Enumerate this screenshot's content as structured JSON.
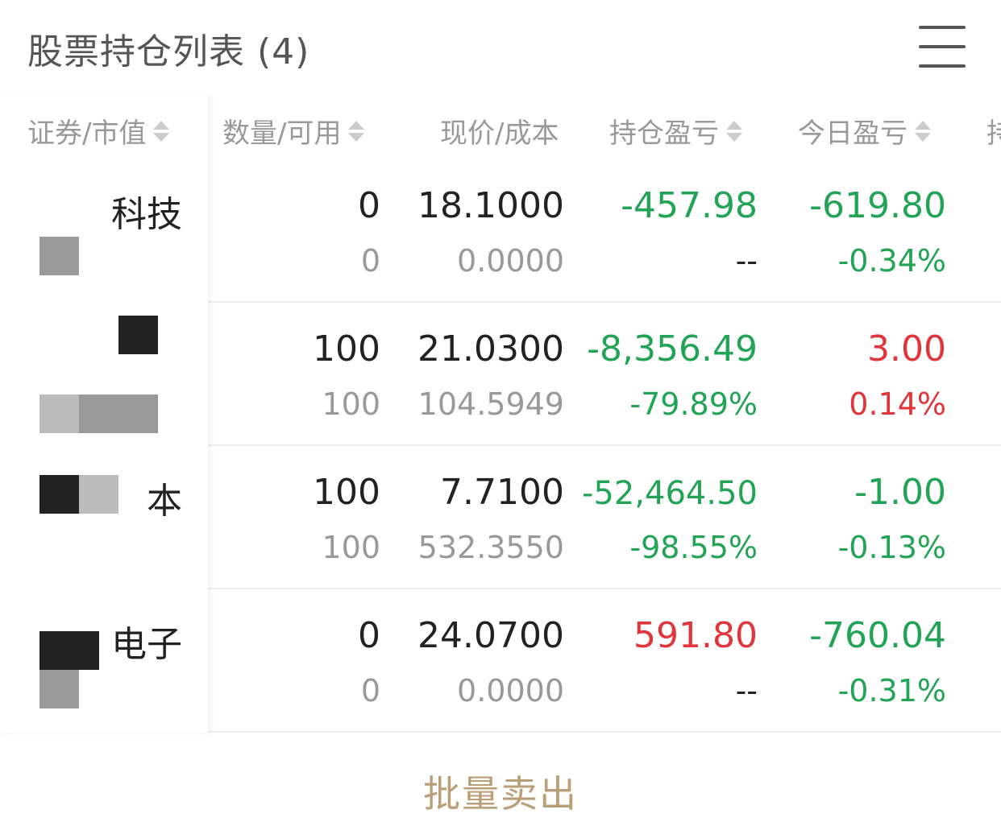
{
  "header": {
    "title": "股票持仓列表 (4)",
    "menu_icon": "hamburger-menu-icon"
  },
  "columns": [
    {
      "label": "证券/市值",
      "sortable": true
    },
    {
      "label": "数量/可用",
      "sortable": true
    },
    {
      "label": "现价/成本",
      "sortable": false
    },
    {
      "label": "持仓盈亏",
      "sortable": true
    },
    {
      "label": "今日盈亏",
      "sortable": true
    },
    {
      "label": "持",
      "sortable": false
    }
  ],
  "rows": [
    {
      "name": "科技",
      "qty": "0",
      "available": "0",
      "price": "18.1000",
      "cost": "0.0000",
      "pos_pl": "-457.98",
      "pos_pl_pct": "--",
      "day_pl": "-619.80",
      "day_pl_pct": "-0.34%"
    },
    {
      "name": "",
      "qty": "100",
      "available": "100",
      "price": "21.0300",
      "cost": "104.5949",
      "pos_pl": "-8,356.49",
      "pos_pl_pct": "-79.89%",
      "day_pl": "3.00",
      "day_pl_pct": "0.14%"
    },
    {
      "name": "本",
      "qty": "100",
      "available": "100",
      "price": "7.7100",
      "cost": "532.3550",
      "pos_pl": "-52,464.50",
      "pos_pl_pct": "-98.55%",
      "day_pl": "-1.00",
      "day_pl_pct": "-0.13%"
    },
    {
      "name": "电子",
      "qty": "0",
      "available": "0",
      "price": "24.0700",
      "cost": "0.0000",
      "pos_pl": "591.80",
      "pos_pl_pct": "--",
      "day_pl": "-760.04",
      "day_pl_pct": "-0.31%"
    }
  ],
  "footer": {
    "batch_sell_label": "批量卖出"
  },
  "colors": {
    "loss": "#22a356",
    "gain": "#e0353b",
    "accent": "#b89f78"
  }
}
